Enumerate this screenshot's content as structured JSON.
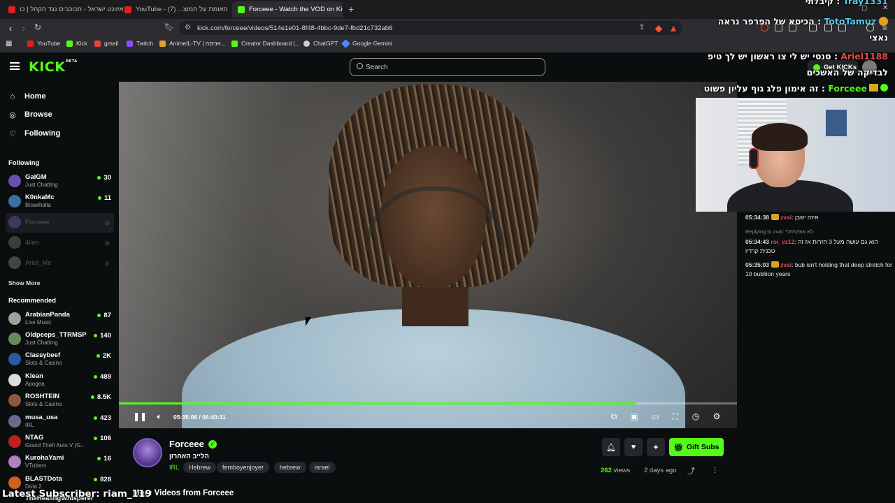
{
  "browser": {
    "tabs": [
      {
        "label": "איוונט ישראל - הכוכבים נגד הקהל | כו",
        "color": "#e02020"
      },
      {
        "label": "YouTube - האומת על חמוצ... (7)",
        "color": "#e02020"
      },
      {
        "label": "Forceee - Watch the VOD on Kick",
        "color": "#53fc18"
      }
    ],
    "url": "kick.com/forceee/videos/514e1e01-8f48-4bbc-9de7-fbd21c732ab6",
    "bookmarks": [
      {
        "label": "YouTube",
        "color": "#e02020"
      },
      {
        "label": "Kick",
        "color": "#53fc18"
      },
      {
        "label": "gmail",
        "color": "#ea4335"
      },
      {
        "label": "Twitch",
        "color": "#9146ff"
      },
      {
        "label": "AnimeIL-TV | אנימה...",
        "color": "#e0a030"
      },
      {
        "label": "Creator Dashboard |...",
        "color": "#53fc18"
      },
      {
        "label": "ChatGPT",
        "color": "#cfcfcf"
      },
      {
        "label": "Google Gemini",
        "color": "#4b8bf5"
      }
    ]
  },
  "header": {
    "logo": "KICK",
    "logo_badge": "BETA",
    "search_placeholder": "Search",
    "get_kicks": "Get KICKs"
  },
  "sidebar": {
    "nav": [
      {
        "label": "Home",
        "icon": "home-icon"
      },
      {
        "label": "Browse",
        "icon": "compass-icon"
      },
      {
        "label": "Following",
        "icon": "heart-icon"
      }
    ],
    "following_title": "Following",
    "following": [
      {
        "name": "GalGM",
        "category": "Just Chatting",
        "viewers": "30",
        "color": "#6a4fb0"
      },
      {
        "name": "K0nkaMc",
        "category": "Brawlhalla",
        "viewers": "11",
        "color": "#3a6ea5"
      },
      {
        "name": "Forceee",
        "category": "",
        "viewers": "",
        "color": "#7e5bc9"
      },
      {
        "name": "4llen",
        "category": "",
        "viewers": "",
        "color": "#888888"
      },
      {
        "name": "Ariel_Me",
        "category": "",
        "viewers": "",
        "color": "#999999"
      }
    ],
    "show_more": "Show More",
    "recommended_title": "Recommended",
    "recommended": [
      {
        "name": "ArabianPanda",
        "category": "Live Music",
        "viewers": "87",
        "color": "#a0a0a0"
      },
      {
        "name": "Oldpeeps_TTRMSP",
        "category": "Just Chatting",
        "viewers": "140",
        "color": "#6a8a5a"
      },
      {
        "name": "Classybeef",
        "category": "Slots & Casino",
        "viewers": "2K",
        "color": "#2a5aa0"
      },
      {
        "name": "Klean",
        "category": "Apogea",
        "viewers": "489",
        "color": "#dddddd"
      },
      {
        "name": "ROSHTEIN",
        "category": "Slots & Casino",
        "viewers": "8.5K",
        "color": "#8a5a3a"
      },
      {
        "name": "musa_usa",
        "category": "IRL",
        "viewers": "423",
        "color": "#6a6a8a"
      },
      {
        "name": "NTAG",
        "category": "Grand Theft Auto V (G...",
        "viewers": "106",
        "color": "#c02020"
      },
      {
        "name": "KurohaYami",
        "category": "VTubers",
        "viewers": "16",
        "color": "#b080c0"
      },
      {
        "name": "BLASTDota",
        "category": "Dota 2",
        "viewers": "828",
        "color": "#d06020"
      }
    ],
    "partial_channel": "TheHealingWhisperer"
  },
  "player": {
    "elapsed": "05:35:08",
    "duration": "06:40:11",
    "progress_fraction": 0.837
  },
  "video_info": {
    "channel": "Forceee",
    "title": "הלייב האחרון",
    "category": "IRL",
    "tags": [
      "Hebrew",
      "femboyenjoyer",
      "hebrew",
      "israel"
    ],
    "gift_subs": "Gift Subs",
    "views_count": "262",
    "views_label": "views",
    "posted": "2 days ago",
    "more_videos": "More Videos from Forceee"
  },
  "overlay_chat": [
    {
      "user": "Tray1331",
      "text": "קיבלתי",
      "user_color": "#55c8e8"
    },
    {
      "user": "TotoTamuz",
      "text": "הכיסא של הפרפר נראה נאצי",
      "user_color": "#55c8e8"
    },
    {
      "user": "Ariel1188",
      "text": "סנסי יש לי צו ראשון יש לך טיפ לבדיקה של האשכים",
      "user_color": "#e64a4a"
    },
    {
      "user": "Forceee",
      "text": "זה אימון פלג גוף עליון פשוט",
      "user_color": "#53fc18"
    }
  ],
  "chat": {
    "messages": [
      {
        "time": "05:34:38",
        "user": "zvai",
        "text": "איזה ישבן",
        "reply": ""
      },
      {
        "time": "05:34:43",
        "user": "roi_vz12",
        "text": "הוא גם עושה מעל 3 חזרות אז זה טכנית קרדיו",
        "reply": "Replying to zvai: לא אופטימלי"
      },
      {
        "time": "05:35:03",
        "user": "zvai",
        "text": "bub isn't holding that deep stretch for 10 bubliion years",
        "reply": ""
      }
    ]
  },
  "ticker": {
    "prefix": "Latest Subscriber:",
    "name": "riam_119"
  },
  "colors": {
    "kick_green": "#53fc18",
    "background": "#0b0e0f"
  }
}
